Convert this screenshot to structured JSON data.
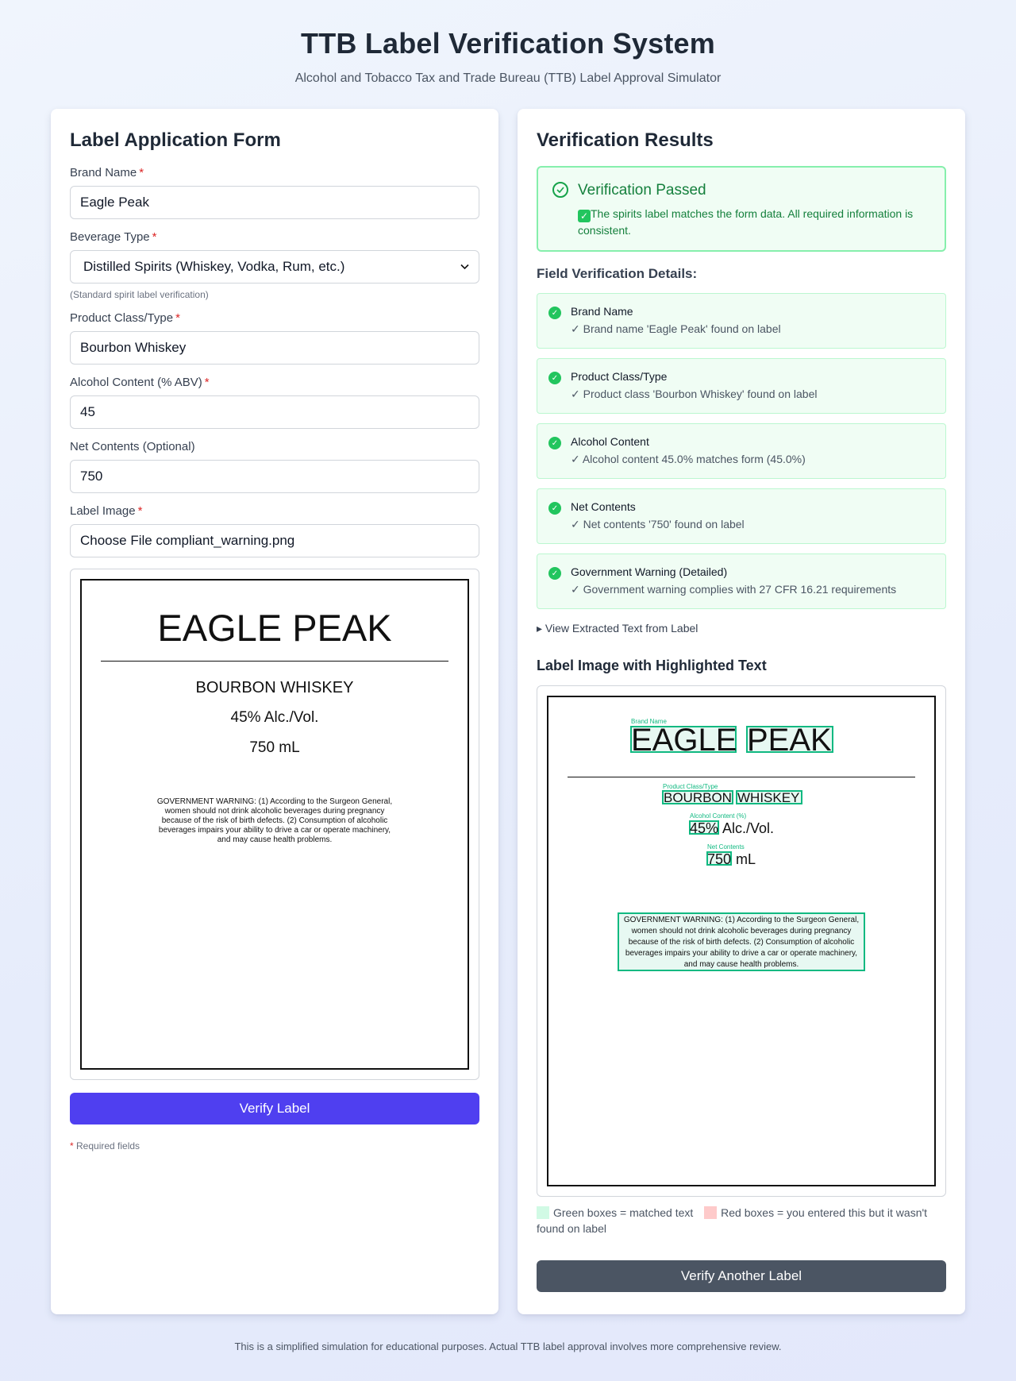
{
  "header": {
    "title": "TTB Label Verification System",
    "subtitle": "Alcohol and Tobacco Tax and Trade Bureau (TTB) Label Approval Simulator"
  },
  "form": {
    "title": "Label Application Form",
    "brand": {
      "label": "Brand Name",
      "value": "Eagle Peak"
    },
    "beverage": {
      "label": "Beverage Type",
      "value": "Distilled Spirits (Whiskey, Vodka, Rum, etc.)",
      "hint": "(Standard spirit label verification)"
    },
    "product_class": {
      "label": "Product Class/Type",
      "value": "Bourbon Whiskey"
    },
    "abv": {
      "label": "Alcohol Content (% ABV)",
      "value": "45"
    },
    "net": {
      "label": "Net Contents (Optional)",
      "value": "750"
    },
    "image": {
      "label": "Label Image",
      "value": "Choose File compliant_warning.png"
    },
    "required_star": "*",
    "verify_button": "Verify Label",
    "required_note": "Required fields"
  },
  "label_art": {
    "brand": "EAGLE PEAK",
    "class": "BOURBON WHISKEY",
    "abv": "45% Alc./Vol.",
    "net": "750 mL",
    "warning": "GOVERNMENT WARNING: (1) According to the Surgeon General, women should not drink alcoholic beverages during pregnancy because of the risk of birth defects. (2) Consumption of alcoholic beverages impairs your ability to drive a car or operate machinery, and may cause health problems."
  },
  "results": {
    "title": "Verification Results",
    "status_title": "Verification Passed",
    "status_message": "The spirits label matches the form data. All required information is consistent.",
    "details_title": "Field Verification Details:",
    "details": [
      {
        "name": "Brand Name",
        "message": "✓ Brand name 'Eagle Peak' found on label"
      },
      {
        "name": "Product Class/Type",
        "message": "✓ Product class 'Bourbon Whiskey' found on label"
      },
      {
        "name": "Alcohol Content",
        "message": "✓ Alcohol content 45.0% matches form (45.0%)"
      },
      {
        "name": "Net Contents",
        "message": "✓ Net contents '750' found on label"
      },
      {
        "name": "Government Warning (Detailed)",
        "message": "✓ Government warning complies with 27 CFR 16.21 requirements"
      }
    ],
    "extracted_toggle": "View Extracted Text from Label",
    "highlight_title": "Label Image with Highlighted Text",
    "highlight": {
      "tag_brand": "Brand Name",
      "word_eagle": "EAGLE",
      "word_peak": "PEAK",
      "tag_class": "Product Class/Type",
      "word_bourbon": "BOURBON",
      "word_whiskey": "WHISKEY",
      "tag_abv": "Alcohol Content (%)",
      "word_45": "45%",
      "word_alcvol": "Alc./Vol.",
      "tag_net": "Net Contents",
      "word_750": "750",
      "word_ml": "mL"
    },
    "legend_green": "Green boxes = matched text",
    "legend_red": "Red boxes = you entered this but it wasn't found on label",
    "again_button": "Verify Another Label"
  },
  "footer": "This is a simplified simulation for educational purposes. Actual TTB label approval involves more comprehensive review.",
  "colors": {
    "primary": "#4f3ff0",
    "success": "#22c55e",
    "secondary": "#4b5563"
  }
}
